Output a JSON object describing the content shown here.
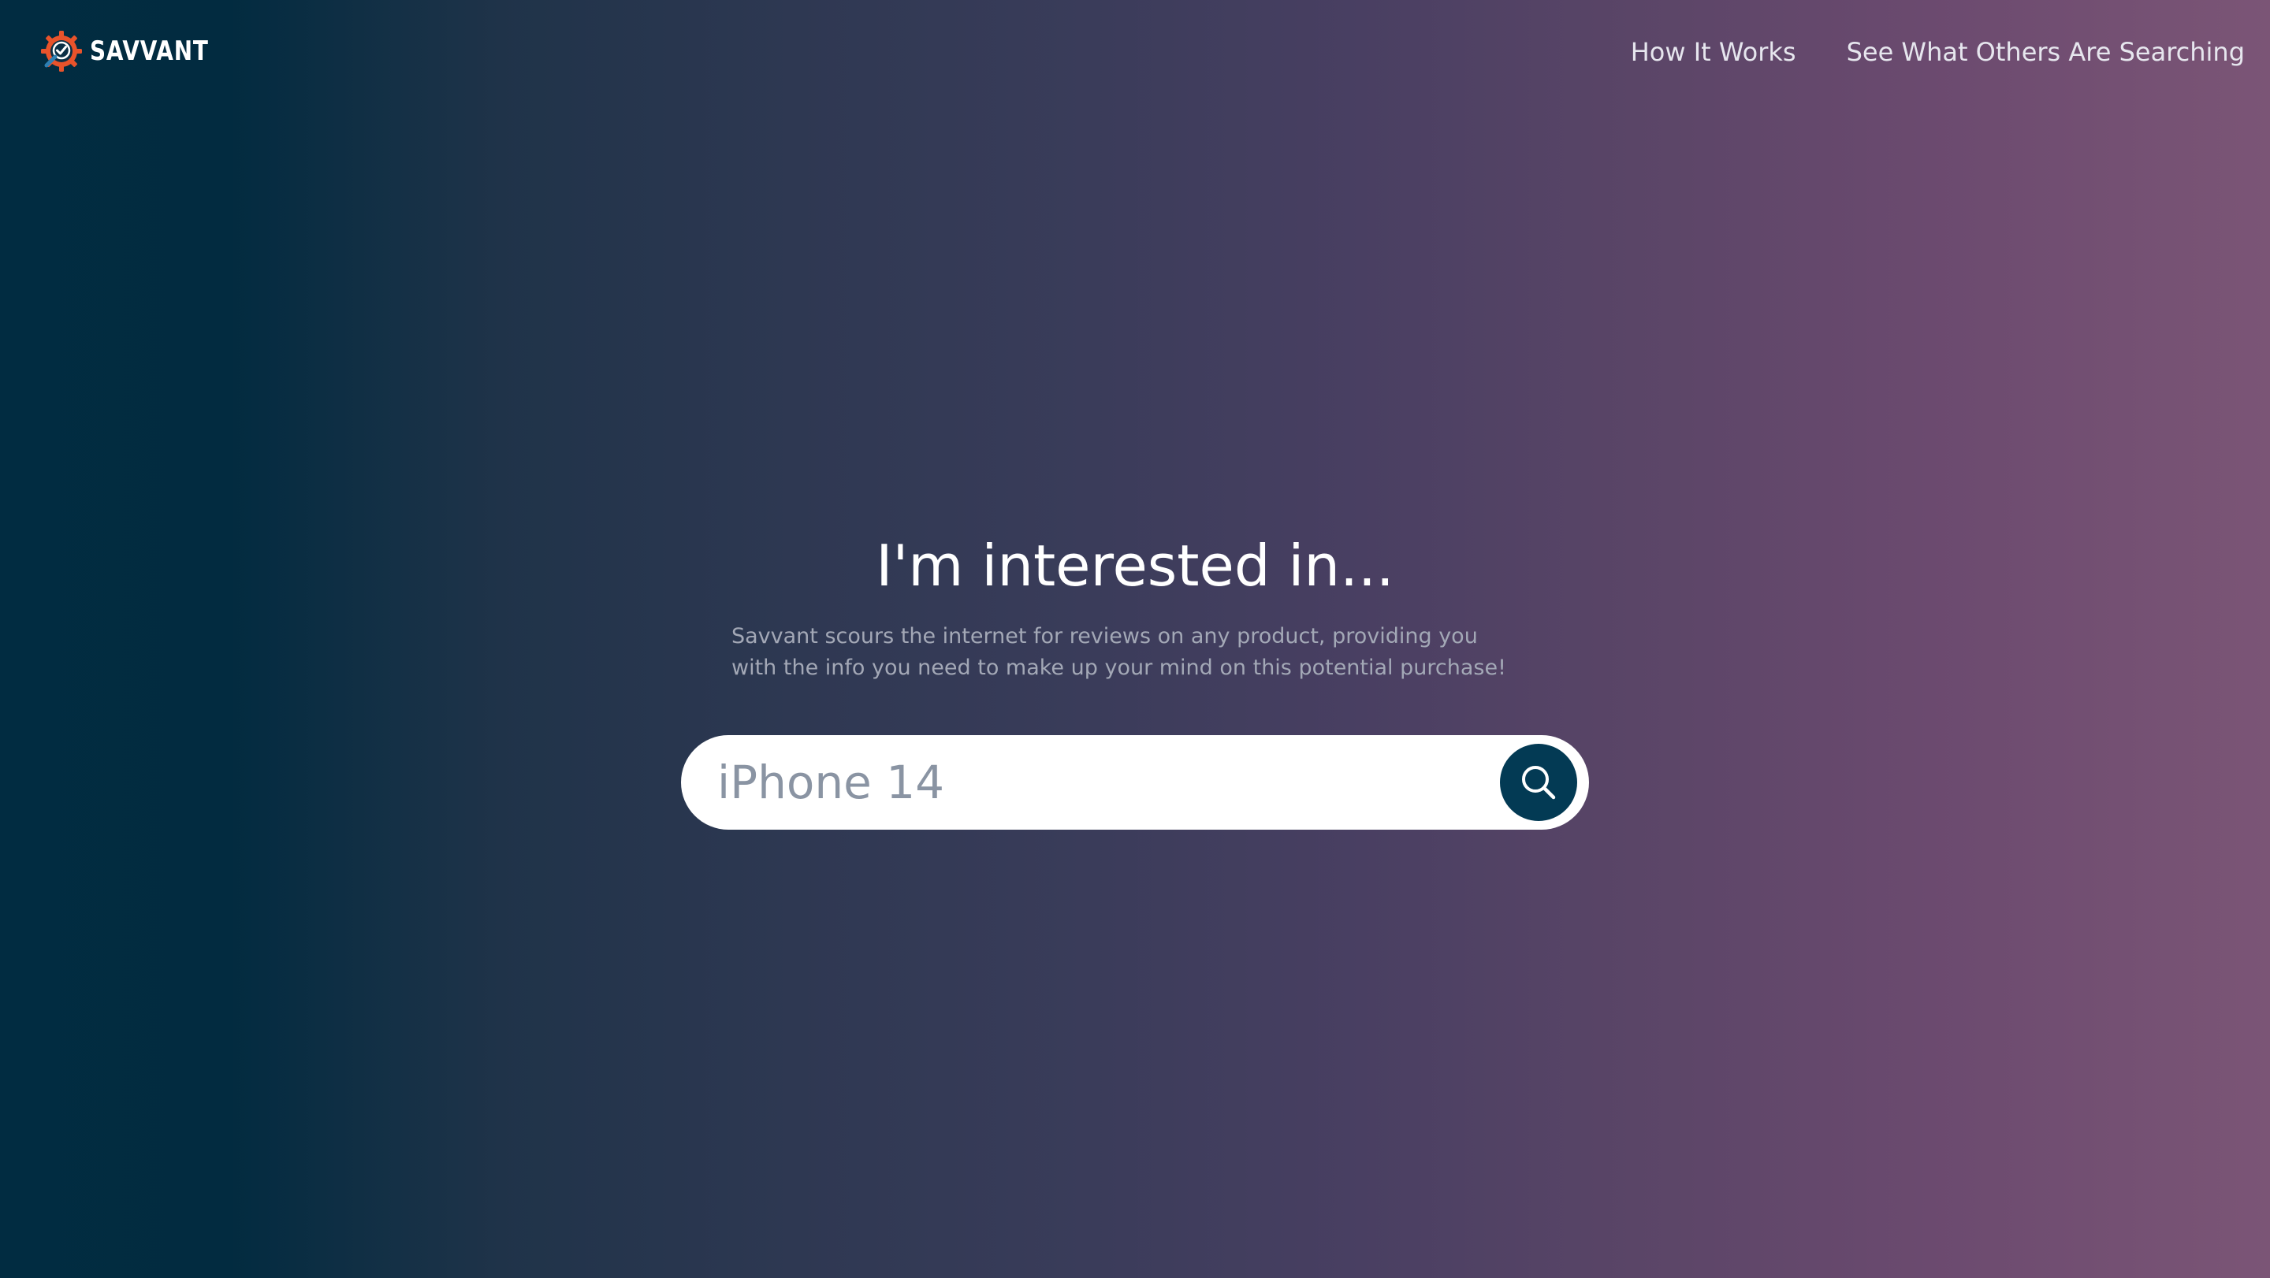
{
  "header": {
    "brand_name": "SAVVANT",
    "logo_icon": "gear-magnifier-check-logo",
    "nav": {
      "how_it_works": "How It Works",
      "see_others_searching": "See What Others Are Searching"
    }
  },
  "hero": {
    "title": "I'm interested in...",
    "subtitle": "Savvant scours the internet for reviews on any product, providing you with the info you need to make up your mind on this potential purchase!"
  },
  "search": {
    "value": "",
    "placeholder": "iPhone 14",
    "button_icon": "search-icon"
  },
  "colors": {
    "gradient_start": "#012c41",
    "gradient_end": "#7b5576",
    "search_button": "#033a54",
    "logo_orange": "#e8532b"
  }
}
